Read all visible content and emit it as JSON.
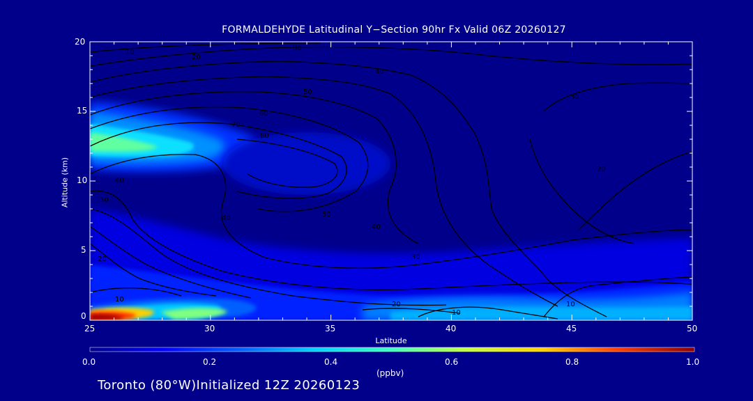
{
  "chart_data": {
    "type": "heatmap",
    "title": "FORMALDEHYDE Latitudinal Y−Section 90hr  Fx Valid 06Z 20260127",
    "xlabel": "Latitude",
    "ylabel": "Altitude (km)",
    "xlim": [
      25,
      50
    ],
    "ylim": [
      0,
      20
    ],
    "x_ticks": [
      "25",
      "30",
      "35",
      "40",
      "45",
      "50"
    ],
    "y_ticks": [
      "0",
      "5",
      "10",
      "15",
      "20"
    ],
    "grid": false,
    "colorbar": {
      "ticks": [
        "0.0",
        "0.2",
        "0.4",
        "0.6",
        "0.8",
        "1.0"
      ],
      "units": "(ppbv)",
      "min": 0.0,
      "max": 1.0
    },
    "fill_features": [
      {
        "lat": 25.5,
        "alt": 12.5,
        "value": 0.45,
        "desc": "upper tongue core"
      },
      {
        "lat": 26.0,
        "alt": 0.15,
        "value": 0.95,
        "desc": "surface maximum"
      },
      {
        "lat": 30.0,
        "alt": 0.6,
        "value": 0.35,
        "desc": "surface plume"
      },
      {
        "lat": 42.0,
        "alt": 0.8,
        "value": 0.15,
        "desc": "low-level band"
      }
    ],
    "contour_labels": [
      "10",
      "20",
      "30",
      "40",
      "50",
      "60",
      "70",
      "80"
    ]
  },
  "footer": {
    "text": "Toronto (80°W)Initialized 12Z 20260123"
  }
}
